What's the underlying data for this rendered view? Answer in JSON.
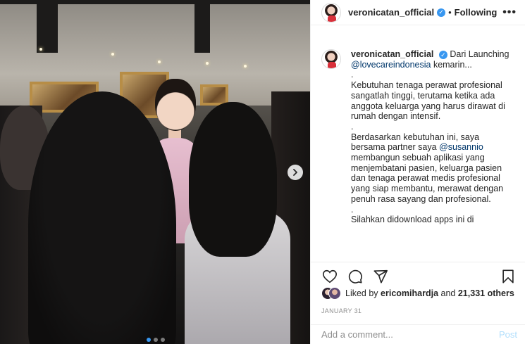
{
  "header": {
    "username": "veronicatan_official",
    "separator": "•",
    "follow_label": "Following",
    "more_label": "•••"
  },
  "caption": {
    "username": "veronicatan_official",
    "paragraphs": [
      "Dari Launching",
      "@lovecareindonesia",
      "kemarin...",
      ".",
      "Kebutuhan tenaga perawat profesional sangatlah tinggi, terutama ketika ada anggota keluarga yang harus dirawat di rumah dengan intensif.",
      ".",
      "Berdasarkan kebutuhan ini, saya bersama partner saya",
      "@susannio",
      "membangun sebuah aplikasi yang menjembatani pasien, keluarga pasien dan tenaga perawat medis profesional yang siap membantu, merawat dengan penuh rasa sayang dan profesional.",
      ".",
      "Silahkan didownload apps ini di"
    ]
  },
  "actions": {
    "like": "heart-icon",
    "comment": "comment-icon",
    "share": "share-icon",
    "save": "bookmark-icon"
  },
  "likes": {
    "prefix": "Liked by",
    "user": "ericomihardja",
    "and": "and",
    "others": "21,331 others"
  },
  "date": "JANUARY 31",
  "comment": {
    "placeholder": "Add a comment...",
    "post_label": "Post"
  },
  "colors": {
    "accent": "#3897f0",
    "post_disabled": "#b2dffc",
    "mention": "#00376b"
  },
  "carousel": {
    "next_icon": "chevron-right-icon",
    "count": 3,
    "active": 0
  }
}
